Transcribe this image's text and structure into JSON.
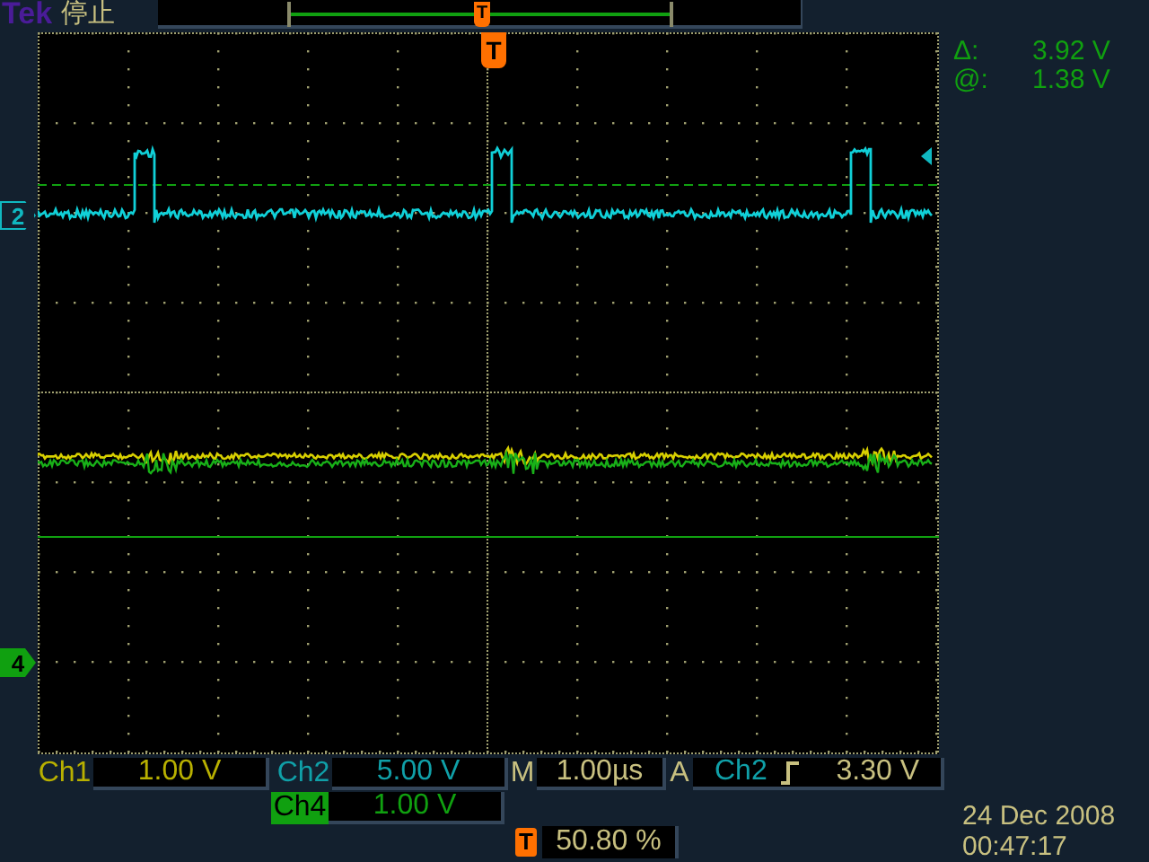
{
  "header": {
    "brand": "Tek",
    "status": "停止"
  },
  "record_view": {
    "trigger_label": "T"
  },
  "screen": {
    "trigger_label": "T"
  },
  "channel_markers": [
    {
      "label": "2",
      "color": "#10b8c0",
      "selected": false
    },
    {
      "label": "4",
      "color": "#10a010",
      "selected": true
    }
  ],
  "readouts": [
    {
      "label": "Δ:",
      "value": "3.92 V"
    },
    {
      "label": "@:",
      "value": "1.38 V"
    }
  ],
  "channels": [
    {
      "label": "Ch1",
      "value": "1.00 V",
      "color": "#b8b000",
      "selected": false
    },
    {
      "label": "Ch2",
      "value": "5.00 V",
      "color": "#10a0a8",
      "selected": false
    },
    {
      "label": "Ch4",
      "value": "1.00 V",
      "color": "#10a010",
      "selected": true
    }
  ],
  "timebase": {
    "label": "M",
    "value": "1.00µs"
  },
  "trigger": {
    "label": "A",
    "source": "Ch2",
    "level": "3.30 V"
  },
  "trigger_position": {
    "label": "T",
    "value": "50.80 %"
  },
  "date": "24 Dec 2008",
  "time": "00:47:17"
}
